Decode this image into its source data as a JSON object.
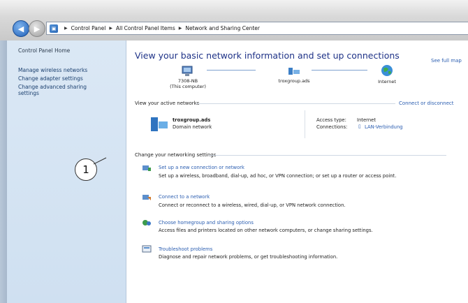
{
  "address_bar": {
    "crumbs": [
      "Control Panel",
      "All Control Panel Items",
      "Network and Sharing Center"
    ]
  },
  "sidebar": {
    "home": "Control Panel Home",
    "items": [
      {
        "label": "Manage wireless networks"
      },
      {
        "label": "Change adapter settings"
      },
      {
        "label": "Change advanced sharing settings"
      }
    ]
  },
  "main": {
    "heading": "View your basic network information and set up connections",
    "see_full_map": "See full map",
    "map": {
      "computer": {
        "name": "7308-NB",
        "sub": "(This computer)"
      },
      "network": {
        "name": "troxgroup.ads"
      },
      "internet": {
        "name": "Internet"
      }
    },
    "active": {
      "title": "View your active networks",
      "connect_link": "Connect or disconnect",
      "network_name": "troxgroup.ads",
      "network_type": "Domain network",
      "access_label": "Access type:",
      "access_value": "Internet",
      "conn_label": "Connections:",
      "conn_value": "LAN-Verbindung"
    },
    "settings": {
      "title": "Change your networking settings",
      "items": [
        {
          "title": "Set up a new connection or network",
          "desc": "Set up a wireless, broadband, dial-up, ad hoc, or VPN connection; or set up a router or access point."
        },
        {
          "title": "Connect to a network",
          "desc": "Connect or reconnect to a wireless, wired, dial-up, or VPN network connection."
        },
        {
          "title": "Choose homegroup and sharing options",
          "desc": "Access files and printers located on other network computers, or change sharing settings."
        },
        {
          "title": "Troubleshoot problems",
          "desc": "Diagnose and repair network problems, or get troubleshooting information."
        }
      ]
    }
  },
  "callout": {
    "label": "1"
  },
  "colors": {
    "link": "#2a5db0",
    "heading": "#1e3287",
    "pane": "#dbe8f5"
  }
}
